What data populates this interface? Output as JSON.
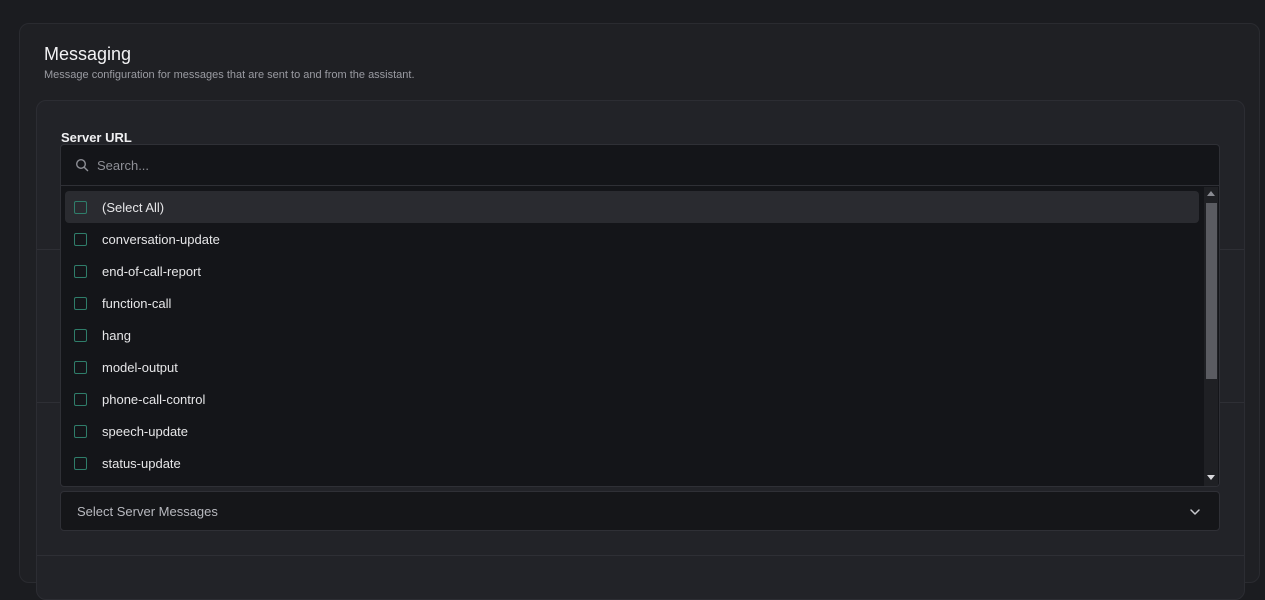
{
  "section": {
    "title": "Messaging",
    "description": "Message configuration for messages that are sent to and from the assistant."
  },
  "server_url": {
    "label": "Server URL"
  },
  "dropdown": {
    "search_placeholder": "Search...",
    "options": [
      {
        "label": "(Select All)",
        "checked": false,
        "highlighted": true
      },
      {
        "label": "conversation-update",
        "checked": false
      },
      {
        "label": "end-of-call-report",
        "checked": false
      },
      {
        "label": "function-call",
        "checked": false
      },
      {
        "label": "hang",
        "checked": false
      },
      {
        "label": "model-output",
        "checked": false
      },
      {
        "label": "phone-call-control",
        "checked": false
      },
      {
        "label": "speech-update",
        "checked": false
      },
      {
        "label": "status-update",
        "checked": false
      }
    ]
  },
  "server_messages_select": {
    "placeholder": "Select Server Messages"
  },
  "icons": {
    "search": "search-icon",
    "chevron": "chevron-down-icon",
    "checkbox": "checkbox-icon"
  },
  "colors": {
    "background": "#1b1c20",
    "card": "#1f2024",
    "dropdown": "#141519",
    "checkbox_border": "#2f7d6a",
    "highlight": "#2a2b30"
  }
}
